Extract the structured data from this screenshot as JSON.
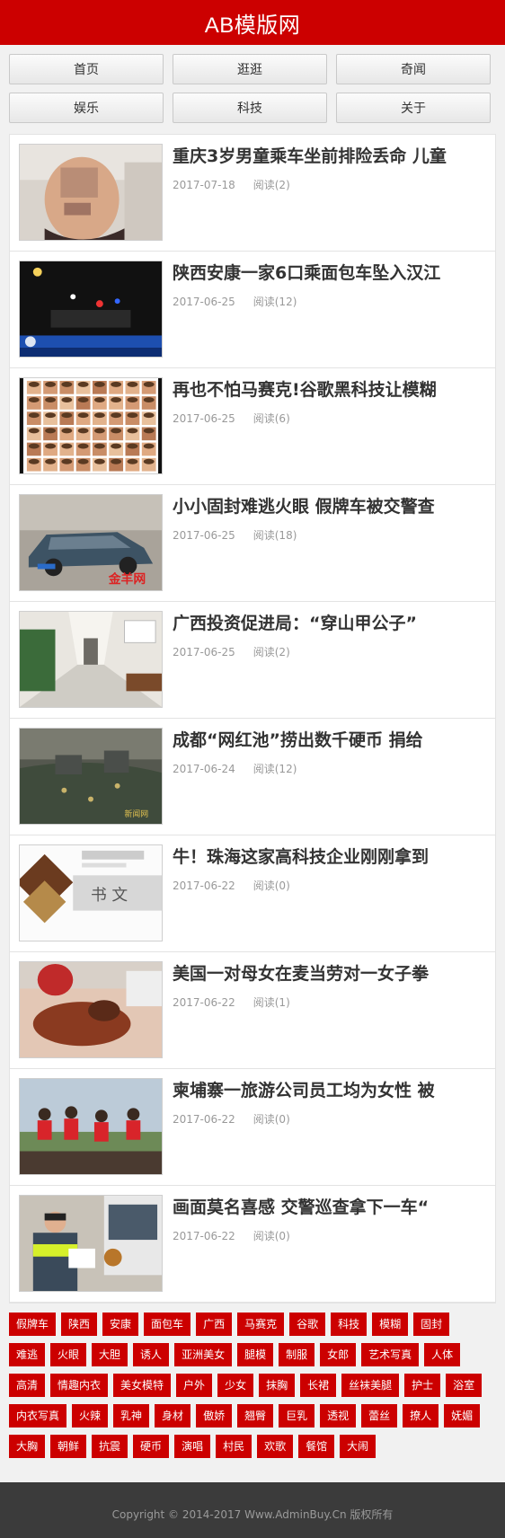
{
  "header": {
    "title": "AB模版网"
  },
  "nav": [
    "首页",
    "逛逛",
    "奇闻",
    "娱乐",
    "科技",
    "关于"
  ],
  "articles": [
    {
      "title": "重庆3岁男童乘车坐前排险丢命 儿童",
      "date": "2017-07-18",
      "reads": "阅读(2)",
      "image": "child-face"
    },
    {
      "title": "陕西安康一家6口乘面包车坠入汉江",
      "date": "2017-06-25",
      "reads": "阅读(12)",
      "image": "night-news"
    },
    {
      "title": "再也不怕马赛克!谷歌黑科技让模糊",
      "date": "2017-06-25",
      "reads": "阅读(6)",
      "image": "face-grid"
    },
    {
      "title": "小小固封难逃火眼 假牌车被交警查",
      "date": "2017-06-25",
      "reads": "阅读(18)",
      "image": "car"
    },
    {
      "title": "广西投资促进局：“穿山甲公子”",
      "date": "2017-06-25",
      "reads": "阅读(2)",
      "image": "corridor"
    },
    {
      "title": "成都“网红池”捞出数千硬币 捐给",
      "date": "2017-06-24",
      "reads": "阅读(12)",
      "image": "pond"
    },
    {
      "title": "牛！珠海这家高科技企业刚刚拿到",
      "date": "2017-06-22",
      "reads": "阅读(0)",
      "image": "brochure"
    },
    {
      "title": "美国一对母女在麦当劳对一女子拳",
      "date": "2017-06-22",
      "reads": "阅读(1)",
      "image": "fight"
    },
    {
      "title": "柬埔寨一旅游公司员工均为女性 被",
      "date": "2017-06-22",
      "reads": "阅读(0)",
      "image": "women"
    },
    {
      "title": "画面莫名喜感 交警巡查拿下一车“",
      "date": "2017-06-22",
      "reads": "阅读(0)",
      "image": "police"
    }
  ],
  "tags": [
    "假牌车",
    "陕西",
    "安康",
    "面包车",
    "广西",
    "马赛克",
    "谷歌",
    "科技",
    "模糊",
    "固封",
    "难逃",
    "火眼",
    "大胆",
    "诱人",
    "亚洲美女",
    "腿模",
    "制服",
    "女郎",
    "艺术写真",
    "人体",
    "高清",
    "情趣内衣",
    "美女模特",
    "户外",
    "少女",
    "抹胸",
    "长裙",
    "丝袜美腿",
    "护士",
    "浴室",
    "内衣写真",
    "火辣",
    "乳神",
    "身材",
    "傲娇",
    "翘臀",
    "巨乳",
    "透视",
    "蕾丝",
    "撩人",
    "妩媚",
    "大胸",
    "朝鲜",
    "抗震",
    "硬币",
    "演唱",
    "村民",
    "欢歌",
    "餐馆",
    "大闹"
  ],
  "footer": {
    "copyright": "Copyright © 2014-2017 Www.AdminBuy.Cn 版权所有"
  },
  "colors": {
    "brand": "#cc0000",
    "footer": "#3b3b3b"
  }
}
